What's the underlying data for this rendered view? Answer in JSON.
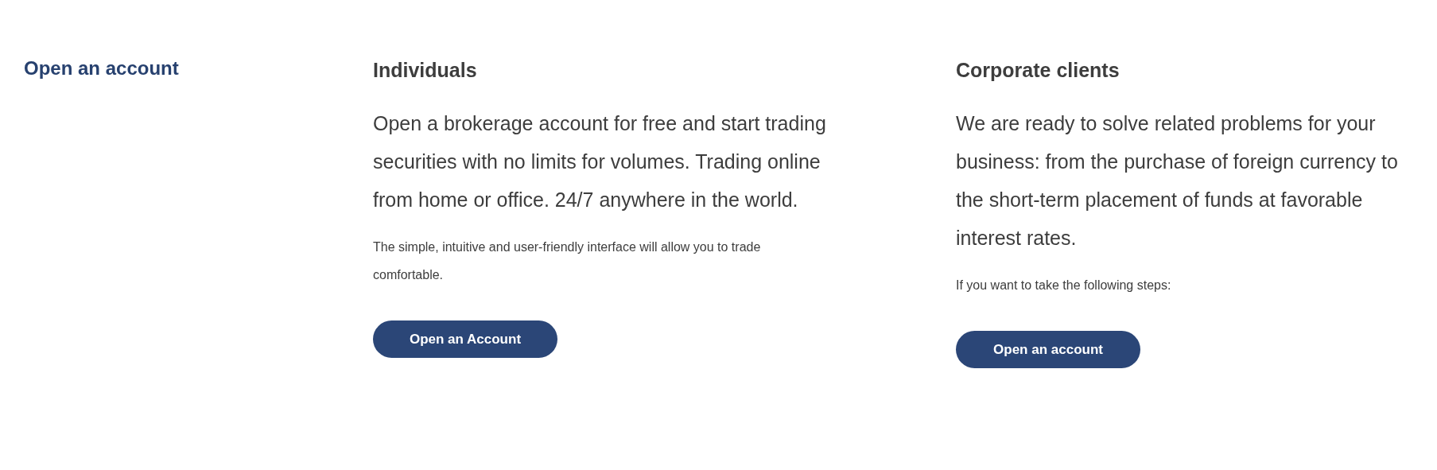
{
  "section_title": "Open an account",
  "columns": [
    {
      "title": "Individuals",
      "lead": "Open a brokerage account for free and start trading securities with no limits for volumes. Trading online from home or office. 24/7 anywhere in the world.",
      "note": "The simple, intuitive and user-friendly interface will allow you to trade comfortable.",
      "button": "Open an Account"
    },
    {
      "title": "Corporate clients",
      "lead": "We are ready to solve related problems for your business: from the purchase of foreign currency to the short-term placement of funds at favorable interest rates.",
      "note": "If you want to take the following steps:",
      "button": "Open an account"
    }
  ]
}
